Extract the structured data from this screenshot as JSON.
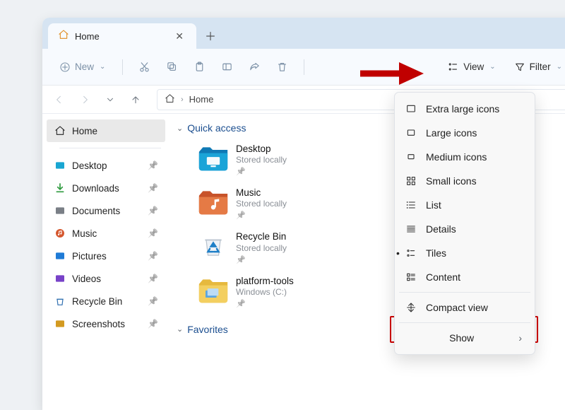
{
  "tab": {
    "title": "Home"
  },
  "toolbar": {
    "new_label": "New",
    "view_label": "View",
    "filter_label": "Filter"
  },
  "breadcrumb": {
    "current": "Home"
  },
  "sidebar": {
    "items": [
      {
        "icon": "home-icon",
        "label": "Home",
        "active": true,
        "pin": false,
        "color": "#e08b1f"
      },
      {
        "icon": "desktop-icon",
        "label": "Desktop",
        "active": false,
        "pin": true,
        "color": "#19a6d2"
      },
      {
        "icon": "downloads-icon",
        "label": "Downloads",
        "active": false,
        "pin": true,
        "color": "#2e9a3e"
      },
      {
        "icon": "documents-icon",
        "label": "Documents",
        "active": false,
        "pin": true,
        "color": "#7a7f86"
      },
      {
        "icon": "music-icon",
        "label": "Music",
        "active": false,
        "pin": true,
        "color": "#d5582f"
      },
      {
        "icon": "pictures-icon",
        "label": "Pictures",
        "active": false,
        "pin": true,
        "color": "#1f7bd6"
      },
      {
        "icon": "videos-icon",
        "label": "Videos",
        "active": false,
        "pin": true,
        "color": "#7842c8"
      },
      {
        "icon": "recyclebin-icon",
        "label": "Recycle Bin",
        "active": false,
        "pin": true,
        "color": "#2f6fb0"
      },
      {
        "icon": "screenshots-icon",
        "label": "Screenshots",
        "active": false,
        "pin": true,
        "color": "#d39a20"
      }
    ]
  },
  "groups": {
    "quick_access_label": "Quick access",
    "favorites_label": "Favorites"
  },
  "tiles": [
    {
      "name": "Desktop",
      "sub": "Stored locally",
      "color1": "#1aa4d8",
      "color2": "#0f79b5"
    },
    {
      "name": "Music",
      "sub": "Stored locally",
      "color1": "#e57a45",
      "color2": "#c8532a"
    },
    {
      "name": "Recycle Bin",
      "sub": "Stored locally",
      "color1": "#e9eef3",
      "color2": "#cfd8e1"
    },
    {
      "name": "platform-tools",
      "sub": "Windows (C:)",
      "color1": "#f3cf60",
      "color2": "#e6b93e"
    }
  ],
  "menu": {
    "items": [
      {
        "id": "extra-large-icons",
        "label": "Extra large icons"
      },
      {
        "id": "large-icons",
        "label": "Large icons"
      },
      {
        "id": "medium-icons",
        "label": "Medium icons"
      },
      {
        "id": "small-icons",
        "label": "Small icons"
      },
      {
        "id": "list",
        "label": "List"
      },
      {
        "id": "details",
        "label": "Details"
      },
      {
        "id": "tiles",
        "label": "Tiles",
        "selected": true
      },
      {
        "id": "content",
        "label": "Content"
      }
    ],
    "compact_label": "Compact view",
    "show_label": "Show"
  }
}
